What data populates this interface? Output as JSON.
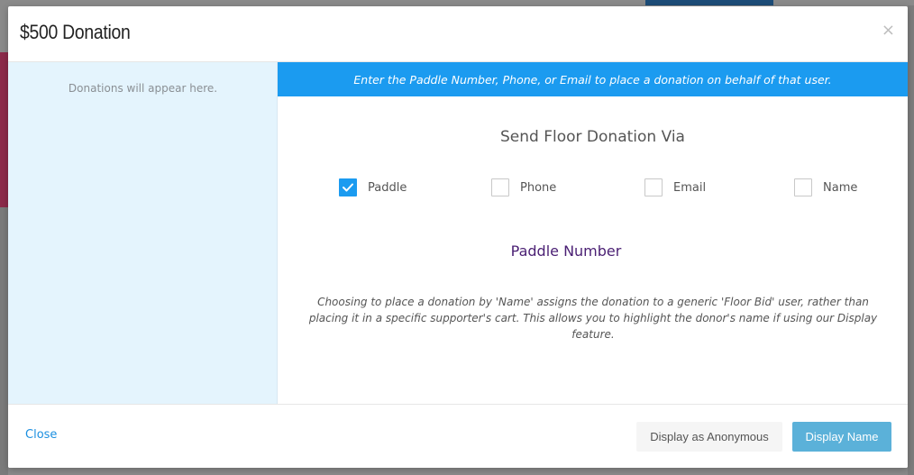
{
  "modal": {
    "title": "$500 Donation",
    "close_symbol": "×"
  },
  "left_panel": {
    "empty_text": "Donations will appear here."
  },
  "banner": {
    "text": "Enter the Paddle Number, Phone, or Email to place a donation on behalf of that user."
  },
  "send_via": {
    "title": "Send Floor Donation Via",
    "options": [
      {
        "label": "Paddle",
        "checked": true
      },
      {
        "label": "Phone",
        "checked": false
      },
      {
        "label": "Email",
        "checked": false
      },
      {
        "label": "Name",
        "checked": false
      }
    ]
  },
  "field": {
    "label": "Paddle Number"
  },
  "note": {
    "text": "Choosing to place a donation by 'Name' assigns the donation to a generic 'Floor Bid' user, rather than placing it in a specific supporter's cart. This allows you to highlight the donor's name if using our Display feature."
  },
  "footer": {
    "close_label": "Close",
    "anonymous_label": "Display as Anonymous",
    "display_name_label": "Display Name"
  },
  "colors": {
    "accent": "#1b9bf0",
    "left_panel_bg": "#e4f4fd",
    "field_label": "#4a1f73",
    "primary_button": "#5bb1d9"
  },
  "icons": {
    "close": "close-icon",
    "checkmark": "check-icon"
  }
}
